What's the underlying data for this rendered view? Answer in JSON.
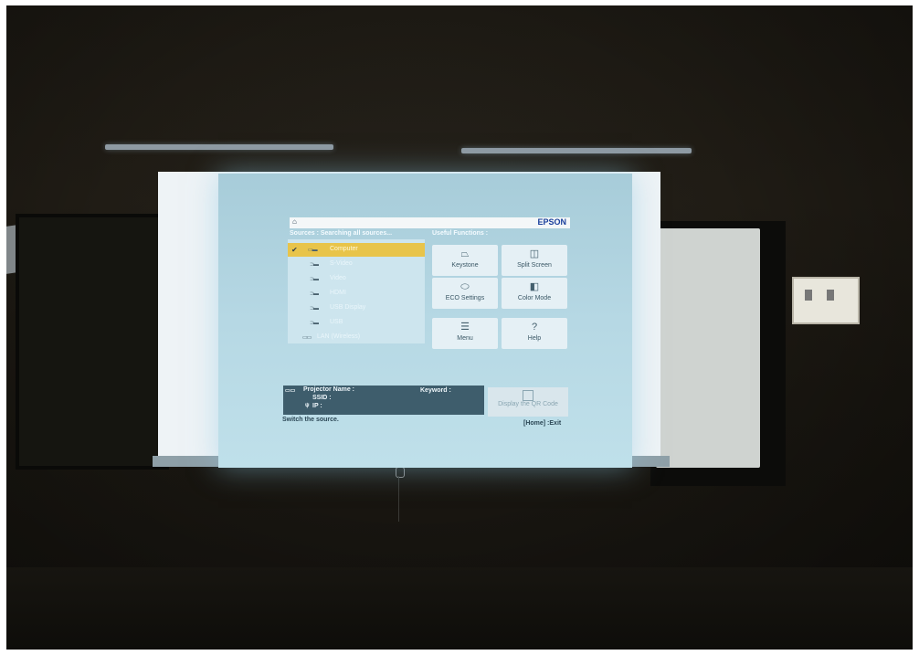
{
  "menu": {
    "brand": "EPSON",
    "sources_header": "Sources :  Searching all sources...",
    "useful_header": "Useful Functions :",
    "sources": [
      {
        "label": "Computer",
        "selected": true,
        "check": "✔"
      },
      {
        "label": "S-Video",
        "selected": false
      },
      {
        "label": "Video",
        "selected": false
      },
      {
        "label": "HDMI",
        "selected": false
      },
      {
        "label": "USB Display",
        "selected": false
      },
      {
        "label": "USB",
        "selected": false
      },
      {
        "label": "LAN (Wireless)",
        "selected": false
      }
    ],
    "functions": [
      {
        "label": "Keystone",
        "icon": "keystone-icon"
      },
      {
        "label": "Split Screen",
        "icon": "split-screen-icon"
      },
      {
        "label": "ECO Settings",
        "icon": "eco-leaf-icon"
      },
      {
        "label": "Color Mode",
        "icon": "color-mode-icon"
      },
      {
        "label": "Menu",
        "icon": "menu-list-icon"
      },
      {
        "label": "Help",
        "icon": "help-icon"
      }
    ],
    "info": {
      "projector_name": "Projector Name :",
      "ssid": "SSID :",
      "ip": "IP :",
      "keyword": "Keyword :"
    },
    "qr_button": "Display the QR Code",
    "status_text": "Switch the source.",
    "exit_hint": "[Home] :Exit"
  },
  "colors": {
    "selected_source": "#e8c44a",
    "menu_background": "#b6d8e4",
    "info_panel": "#3e5d6c",
    "brand_blue": "#1a3f9c"
  }
}
